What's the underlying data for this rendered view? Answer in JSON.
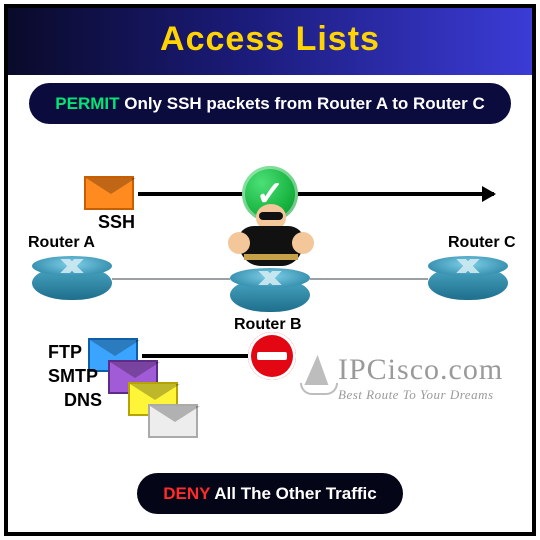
{
  "title": "Access Lists",
  "permit_pill": {
    "keyword": "PERMIT",
    "rest": " Only SSH packets from Router A to Router C"
  },
  "deny_pill": {
    "keyword": "DENY",
    "rest": " All The Other Traffic"
  },
  "routers": {
    "a": "Router A",
    "b": "Router B",
    "c": "Router C"
  },
  "protocols": {
    "ssh": "SSH",
    "ftp": "FTP",
    "smtp": "SMTP",
    "dns": "DNS"
  },
  "check_glyph": "✓",
  "brand": {
    "name": "IPCisco.com",
    "tagline": "Best Route To Your Dreams"
  }
}
